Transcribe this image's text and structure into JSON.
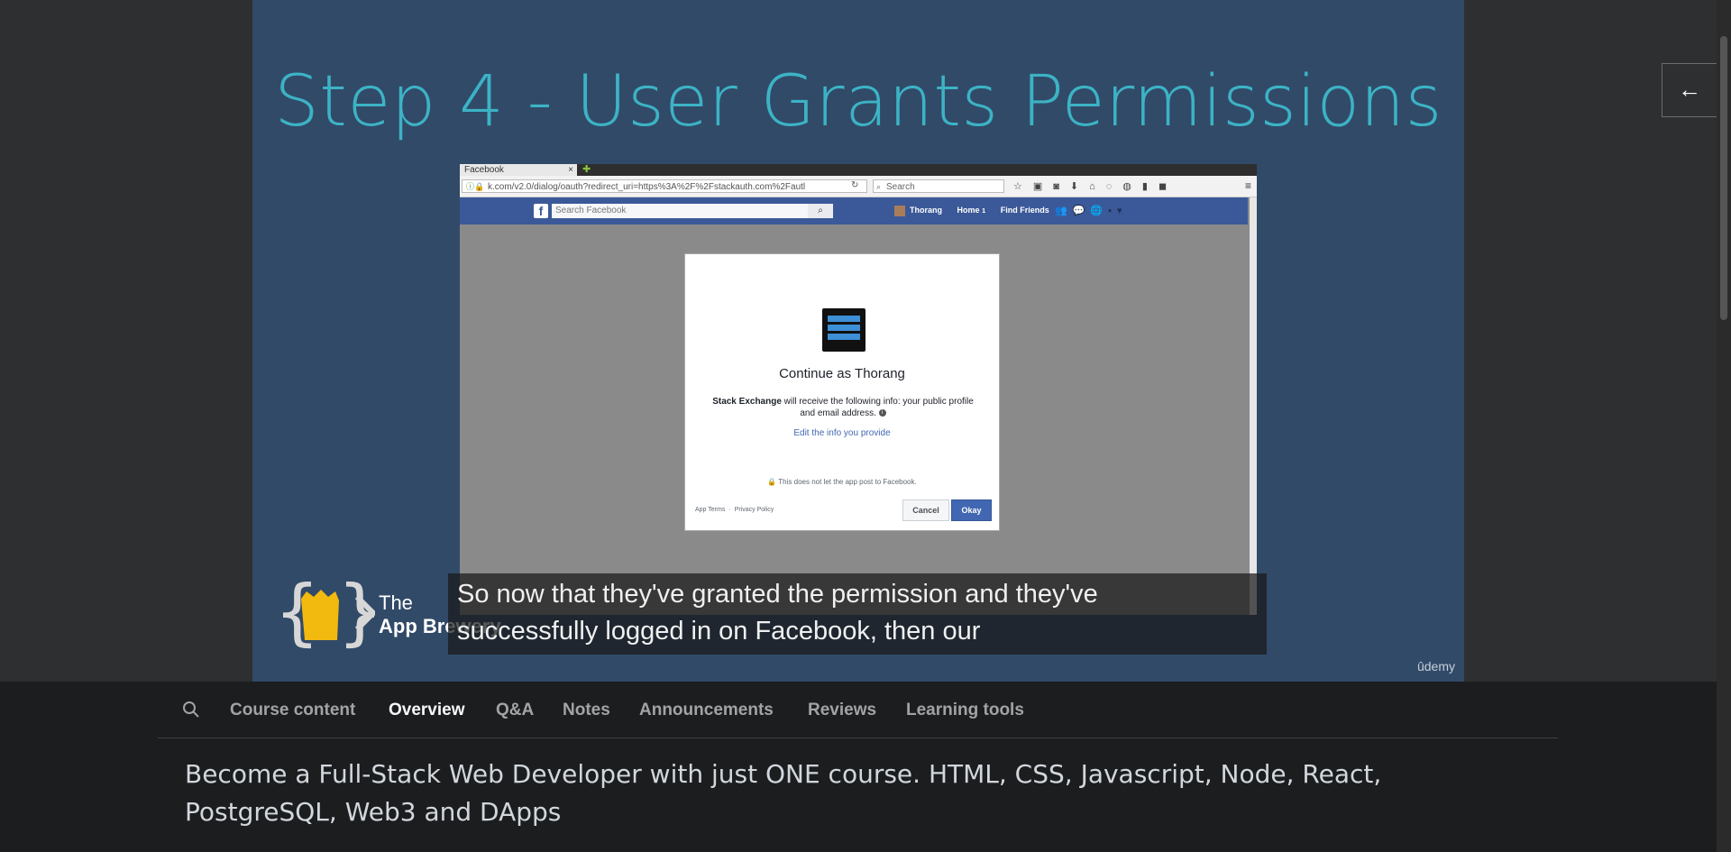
{
  "video": {
    "slide_title": "Step 4 - User Grants Permissions",
    "browser": {
      "tab_label": "Facebook",
      "tab_close": "×",
      "url": "k.com/v2.0/dialog/oauth?redirect_uri=https%3A%2F%2Fstackauth.com%2Fautl",
      "search_placeholder": "Search"
    },
    "facebook": {
      "logo": "f",
      "search_placeholder": "Search Facebook",
      "nav": {
        "user": "Thorang",
        "home": "Home",
        "home_count": "1",
        "find_friends": "Find Friends"
      }
    },
    "dialog": {
      "title": "Continue as Thorang",
      "app_name": "Stack Exchange",
      "body": " will receive the following info: your public profile and email address.",
      "edit_link": "Edit the info you provide",
      "note": "This does not let the app post to Facebook.",
      "footer_terms": "App Terms",
      "footer_privacy": "Privacy Policy",
      "cancel": "Cancel",
      "okay": "Okay"
    },
    "brand": {
      "line1": "The",
      "line2": "App Brewery"
    },
    "captions": {
      "line1": "So now that they've granted the permission and they've",
      "line2": "successfully logged in on Facebook, then our"
    },
    "watermark": "ûdemy"
  },
  "tabs": [
    {
      "label": "Course content"
    },
    {
      "label": "Overview"
    },
    {
      "label": "Q&A"
    },
    {
      "label": "Notes"
    },
    {
      "label": "Announcements"
    },
    {
      "label": "Reviews"
    },
    {
      "label": "Learning tools"
    }
  ],
  "active_tab": "Overview",
  "course_description": "Become a Full-Stack Web Developer with just ONE course. HTML, CSS, Javascript, Node, React, PostgreSQL, Web3 and DApps",
  "icons": {
    "search": "search-icon",
    "collapse": "arrow-left-icon",
    "lock": "lock-icon"
  },
  "colors": {
    "slide_bg": "#314a68",
    "slide_title": "#3cb3c5",
    "facebook_blue": "#3b5998",
    "okay_button": "#4267b2"
  }
}
